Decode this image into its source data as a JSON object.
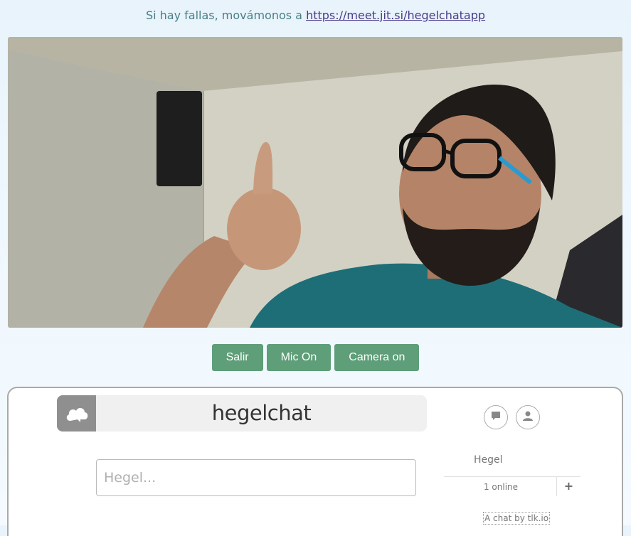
{
  "banner": {
    "prefix": "Si hay fallas, movámonos a ",
    "link_text": "https://meet.jit.si/hegelchatapp"
  },
  "controls": {
    "leave_label": "Salir",
    "mic_label": "Mic On",
    "camera_label": "Camera on"
  },
  "chat": {
    "title": "hegelchat",
    "input_placeholder": "Hegel...",
    "username": "Hegel",
    "online_count": "1 online",
    "add_label": "+",
    "credit": "A chat by tlk.io"
  },
  "colors": {
    "button_green": "#5e9e78",
    "header_grey": "#f0f0f0",
    "logo_grey": "#8f8f8f"
  },
  "icons": {
    "logo": "cloud-icon",
    "chat_toggle": "speech-bubble-icon",
    "user_toggle": "user-icon"
  }
}
